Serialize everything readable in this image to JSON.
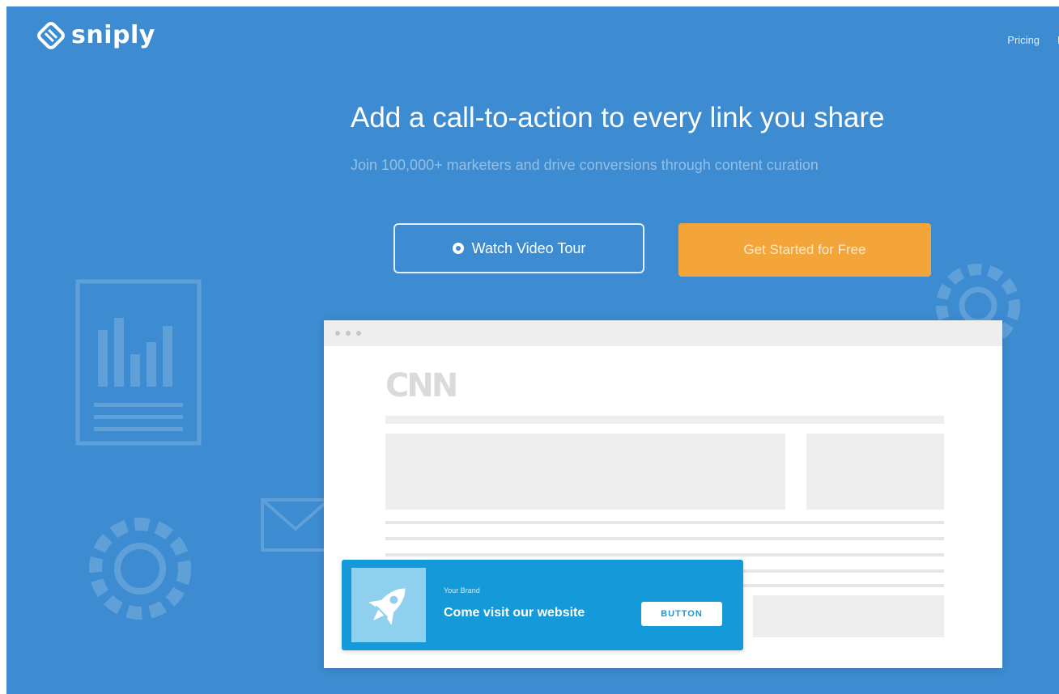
{
  "brand": {
    "name": "sniply",
    "icon": "sniply-logo-icon"
  },
  "nav": {
    "items": [
      {
        "label": "Pricing"
      },
      {
        "label": "F"
      }
    ]
  },
  "hero": {
    "headline": "Add a call-to-action to every link you share",
    "subheadline": "Join 100,000+ marketers and drive conversions through content curation",
    "video_button_label": "Watch Video Tour",
    "video_button_icon": "play-circle-icon",
    "start_button_label": "Get Started for Free"
  },
  "preview": {
    "site_logo": "CNN",
    "cta": {
      "brand": "Your Brand",
      "message": "Come visit our website",
      "button_label": "BUTTON",
      "image_icon": "rocket-icon"
    }
  },
  "colors": {
    "background": "#3d8bd0",
    "accent_orange": "#f3a53a",
    "cta_blue": "#149ad8"
  }
}
